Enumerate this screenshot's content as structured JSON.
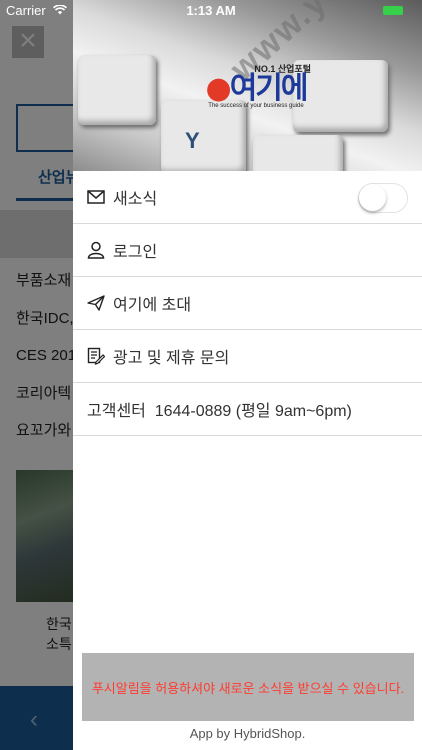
{
  "status_bar": {
    "carrier": "Carrier",
    "time": "1:13 AM"
  },
  "background": {
    "tab": "산업뉴",
    "items": [
      "부품소재",
      "한국IDC,",
      "CES 201",
      "코리아텍",
      "요꼬가와"
    ],
    "caption_line1": "한국",
    "caption_line2": "소특",
    "back_icon": "‹"
  },
  "banner": {
    "logo_tagline": "NO.1 산업포털",
    "logo_text": "여기에",
    "logo_sub": "The success of your business guide",
    "watermark": "www.yeogie.com"
  },
  "menu": {
    "news_label": "새소식",
    "news_toggle_on": false,
    "login_label": "로그인",
    "invite_label": "여기에 초대",
    "ad_label": "광고 및 제휴 문의",
    "support_label": "고객센터",
    "support_phone": "1644-0889",
    "support_hours": "(평일 9am~6pm)"
  },
  "notice": "푸시알림을 허용하셔야 새로운 소식을 받으실 수 있습니다.",
  "footer": "App by HybridShop.",
  "colors": {
    "accent": "#1b5e9b",
    "notice_text": "#ff3b30",
    "battery": "#36d04b"
  }
}
